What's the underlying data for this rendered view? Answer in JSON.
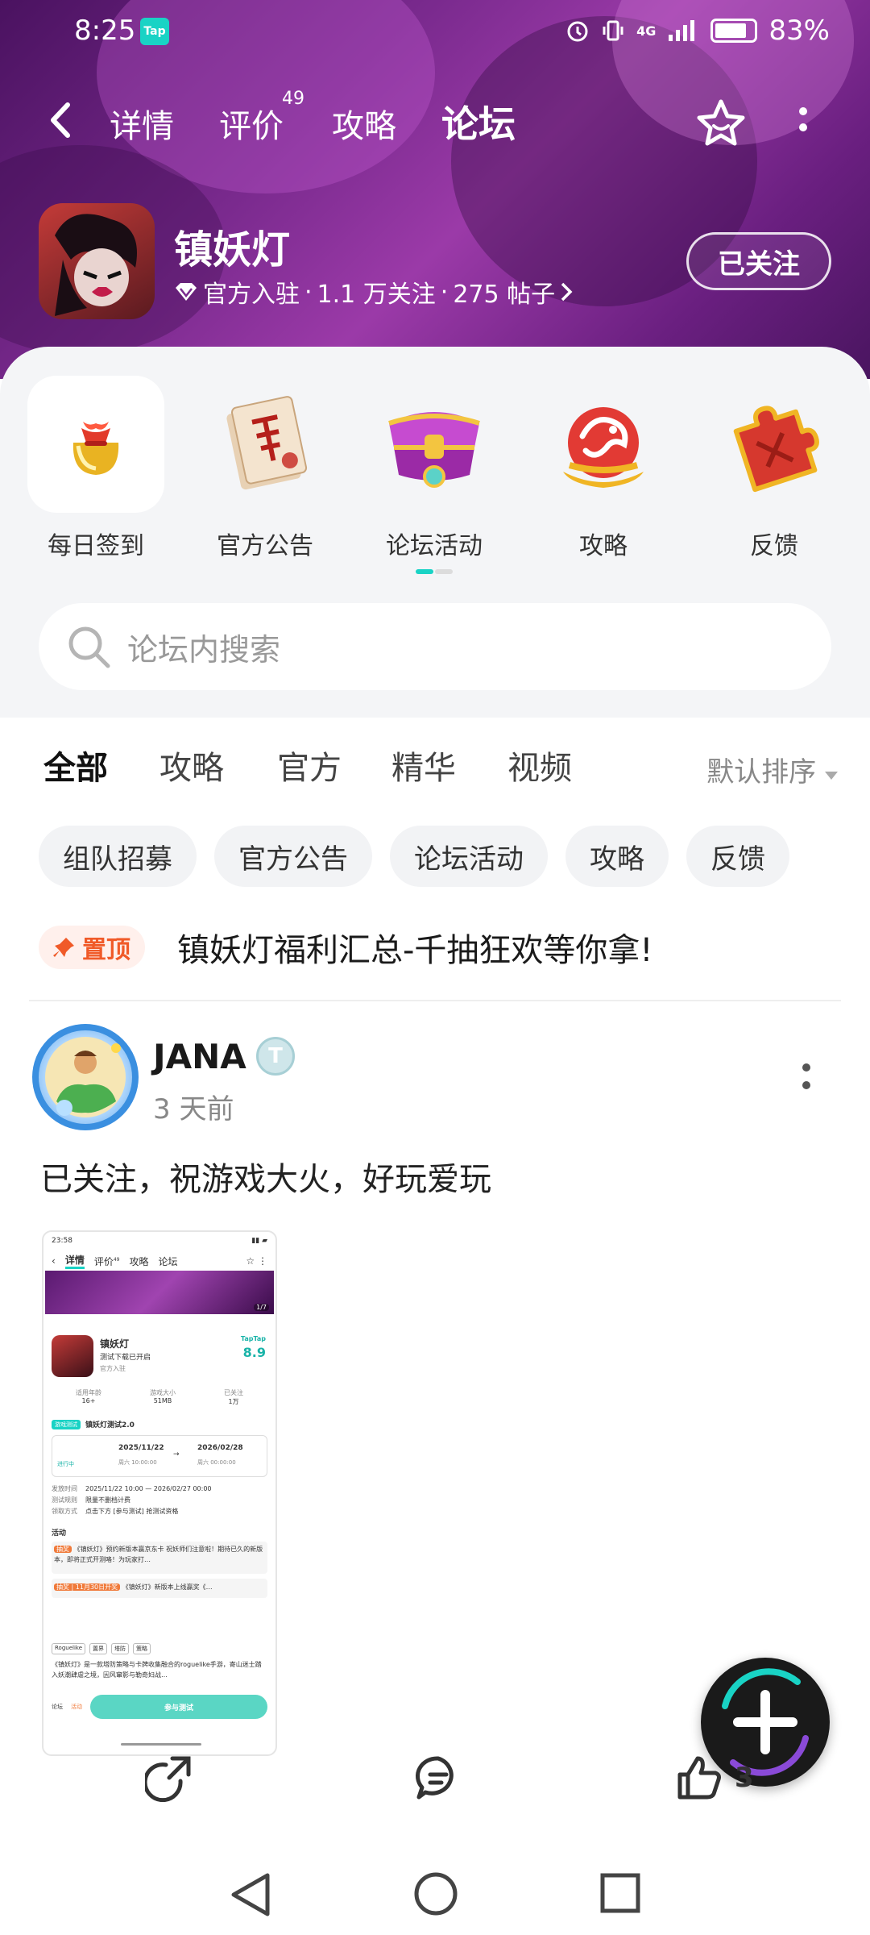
{
  "status": {
    "time": "8:25",
    "app_badge": "Tap",
    "net": "4G",
    "battery": "83%"
  },
  "nav": {
    "tabs": [
      "详情",
      "评价",
      "攻略",
      "论坛"
    ],
    "review_count": "49",
    "active": "论坛"
  },
  "game": {
    "name": "镇妖灯",
    "official": "官方入驻",
    "followers": "1.1 万关注",
    "posts": "275 帖子",
    "sep": "·",
    "follow_label": "已关注"
  },
  "quick": [
    {
      "label": "每日签到",
      "icon": "gift-bag-icon"
    },
    {
      "label": "官方公告",
      "icon": "scroll-notice-icon"
    },
    {
      "label": "论坛活动",
      "icon": "treasure-chest-icon"
    },
    {
      "label": "攻略",
      "icon": "dragon-emblem-icon"
    },
    {
      "label": "反馈",
      "icon": "puzzle-piece-icon"
    }
  ],
  "search": {
    "placeholder": "论坛内搜索"
  },
  "content_tabs": [
    "全部",
    "攻略",
    "官方",
    "精华",
    "视频"
  ],
  "sort": "默认排序",
  "chips": [
    "组队招募",
    "官方公告",
    "论坛活动",
    "攻略",
    "反馈"
  ],
  "pinned": {
    "badge": "置顶",
    "title": "镇妖灯福利汇总-千抽狂欢等你拿!"
  },
  "post": {
    "user": "JANA",
    "user_badge": "T",
    "time": "3 天前",
    "text": "已关注，祝游戏大火，好玩爱玩",
    "shot": {
      "time": "23:58",
      "tabs": [
        "详情",
        "评价",
        "攻略",
        "论坛"
      ],
      "review_count": "49",
      "page": "1/7",
      "name": "镇妖灯",
      "sub": "测试下载已开启",
      "official": "官方入驻",
      "brand": "TapTap",
      "score": "8.9",
      "stats": [
        {
          "k": "适用年龄",
          "v": "16+"
        },
        {
          "k": "游戏大小",
          "v": "51MB"
        },
        {
          "k": "已关注",
          "v": "1万"
        }
      ],
      "test_tag": "游戏测试",
      "test_name": "镇妖灯测试2.0",
      "status": "进行中",
      "start": "2025/11/22",
      "start_time": "周六 10:00:00",
      "end": "2026/02/28",
      "end_time": "周六 00:00:00",
      "rows": [
        {
          "k": "发放时间",
          "v": "2025/11/22 10:00 — 2026/02/27 00:00"
        },
        {
          "k": "测试规则",
          "v": "限量不删档计费"
        },
        {
          "k": "领取方式",
          "v": "点击下方 [参与测试] 抢测试资格"
        }
      ],
      "activity_header": "活动",
      "act1_tag": "抽奖",
      "act1": "《镇妖灯》预约新版本赢京东卡 祝妖师们注意啦！期待已久的新版本，即将正式开测咯！为玩家打…",
      "act2_tag": "抽奖 | 11月30日开奖",
      "act2": "《镇妖灯》新版本上线赢奖《…",
      "tags": [
        "Roguelike",
        "置界",
        "塔防",
        "策略"
      ],
      "desc": "《镇妖灯》是一款塔防策略与卡牌收集融合的roguelike手游，寄山迷士踏入妖潮肆虐之境，因风窜影与勒奇妇战…",
      "bottom": [
        "论坛",
        "活动"
      ],
      "cta": "参与测试"
    }
  },
  "actions": {
    "likes": "3"
  },
  "colors": {
    "accent": "#19d3c5",
    "hero": "#7a2a8e",
    "pin": "#f05a28"
  }
}
